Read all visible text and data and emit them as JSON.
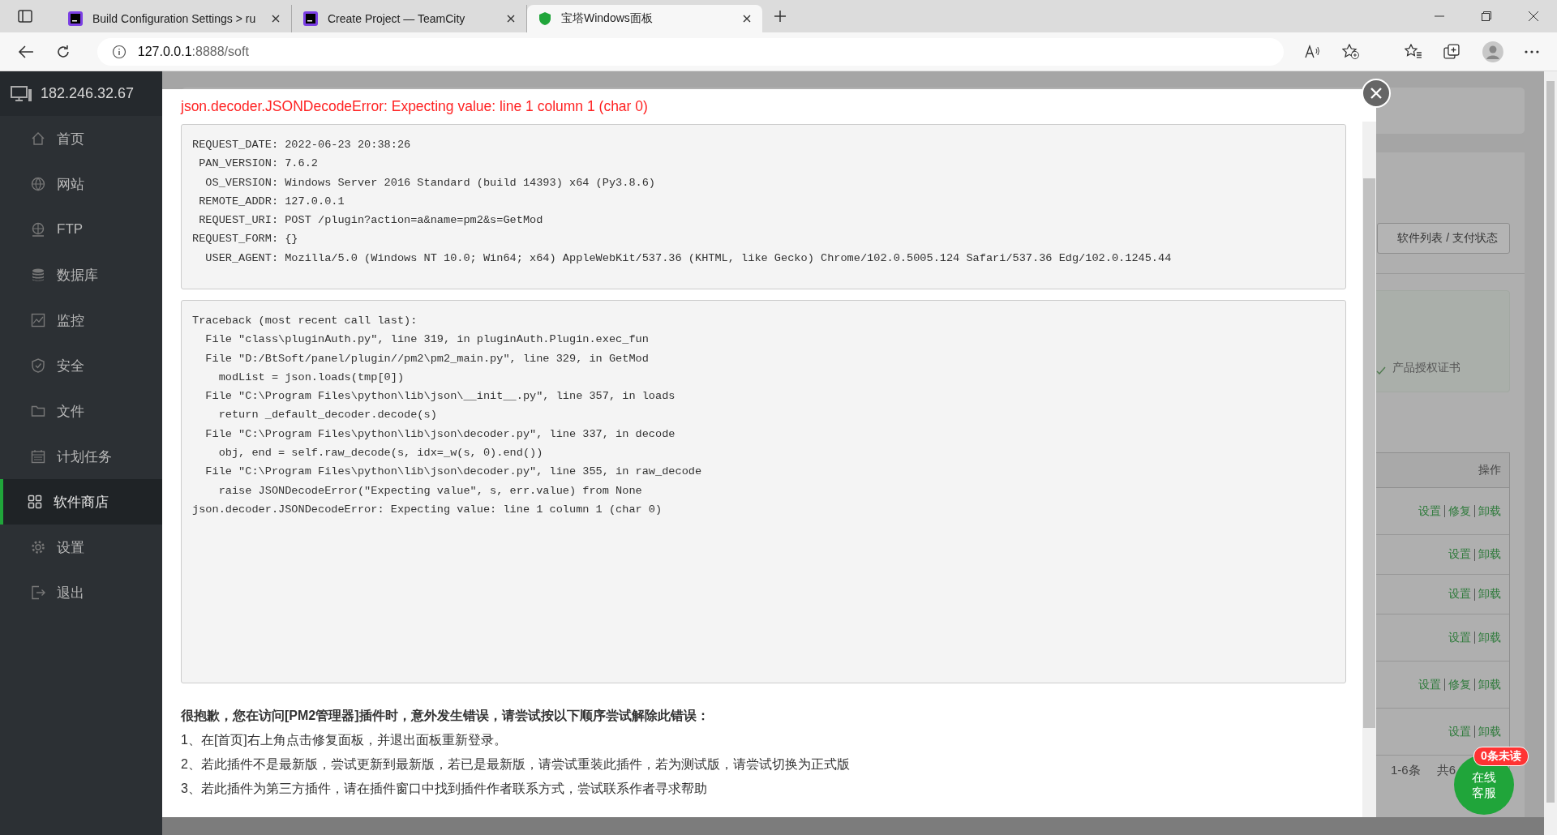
{
  "browser": {
    "tabs": [
      {
        "title": "Build Configuration Settings > ru",
        "kind": "teamcity",
        "selected": false
      },
      {
        "title": "Create Project — TeamCity",
        "kind": "teamcity",
        "selected": false
      },
      {
        "title": "宝塔Windows面板",
        "kind": "shield",
        "selected": true
      }
    ],
    "url": {
      "host": "127.0.0.1",
      "path": ":8888/soft"
    }
  },
  "sidebar": {
    "server": "182.246.32.67",
    "items": [
      {
        "label": "首页",
        "kind": "home",
        "selected": false
      },
      {
        "label": "网站",
        "kind": "globe",
        "selected": false
      },
      {
        "label": "FTP",
        "kind": "ftp",
        "selected": false
      },
      {
        "label": "数据库",
        "kind": "database",
        "selected": false
      },
      {
        "label": "监控",
        "kind": "monitor",
        "selected": false
      },
      {
        "label": "安全",
        "kind": "shield",
        "selected": false
      },
      {
        "label": "文件",
        "kind": "folder",
        "selected": false
      },
      {
        "label": "计划任务",
        "kind": "calendar",
        "selected": false
      },
      {
        "label": "软件商店",
        "kind": "grid",
        "selected": true
      },
      {
        "label": "设置",
        "kind": "gear",
        "selected": false
      },
      {
        "label": "退出",
        "kind": "exit",
        "selected": false
      }
    ]
  },
  "background": {
    "list_button": "软件列表 / 支付状态",
    "certificate": "产品授权证书",
    "table_header": "操作",
    "rows": [
      {
        "actions": [
          "设置",
          "修复",
          "卸载"
        ]
      },
      {
        "actions": [
          "设置",
          "卸载"
        ]
      },
      {
        "actions": [
          "设置",
          "卸载"
        ]
      },
      {
        "actions": [
          "设置",
          "卸载"
        ]
      },
      {
        "actions": [
          "设置",
          "修复",
          "卸载"
        ]
      },
      {
        "actions": [
          "设置",
          "卸载"
        ]
      }
    ],
    "pagination": [
      "1-6条",
      "共6"
    ]
  },
  "chat": {
    "badge": "0条未读",
    "label": [
      "在线",
      "客服"
    ]
  },
  "modal": {
    "error_title": "json.decoder.JSONDecodeError: Expecting value: line 1 column 1 (char 0)",
    "request_info": [
      "REQUEST_DATE: 2022-06-23 20:38:26",
      " PAN_VERSION: 7.6.2",
      "  OS_VERSION: Windows Server 2016 Standard (build 14393) x64 (Py3.8.6)",
      " REMOTE_ADDR: 127.0.0.1",
      " REQUEST_URI: POST /plugin?action=a&name=pm2&s=GetMod",
      "REQUEST_FORM: {}",
      "  USER_AGENT: Mozilla/5.0 (Windows NT 10.0; Win64; x64) AppleWebKit/537.36 (KHTML, like Gecko) Chrome/102.0.5005.124 Safari/537.36 Edg/102.0.1245.44"
    ],
    "traceback": [
      "Traceback (most recent call last):",
      "  File \"class\\pluginAuth.py\", line 319, in pluginAuth.Plugin.exec_fun",
      "  File \"D:/BtSoft/panel/plugin//pm2\\pm2_main.py\", line 329, in GetMod",
      "    modList = json.loads(tmp[0])",
      "  File \"C:\\Program Files\\python\\lib\\json\\__init__.py\", line 357, in loads",
      "    return _default_decoder.decode(s)",
      "  File \"C:\\Program Files\\python\\lib\\json\\decoder.py\", line 337, in decode",
      "    obj, end = self.raw_decode(s, idx=_w(s, 0).end())",
      "  File \"C:\\Program Files\\python\\lib\\json\\decoder.py\", line 355, in raw_decode",
      "    raise JSONDecodeError(\"Expecting value\", s, err.value) from None",
      "json.decoder.JSONDecodeError: Expecting value: line 1 column 1 (char 0)"
    ],
    "help_heading": "很抱歉，您在访问[PM2管理器]插件时，意外发生错误，请尝试按以下顺序尝试解除此错误：",
    "help_lines": [
      "1、在[首页]右上角点击修复面板，并退出面板重新登录。",
      "2、若此插件不是最新版，尝试更新到最新版，若已是最新版，请尝试重装此插件，若为测试版，请尝试切换为正式版",
      "3、若此插件为第三方插件，请在插件窗口中找到插件作者联系方式，尝试联系作者寻求帮助"
    ]
  }
}
